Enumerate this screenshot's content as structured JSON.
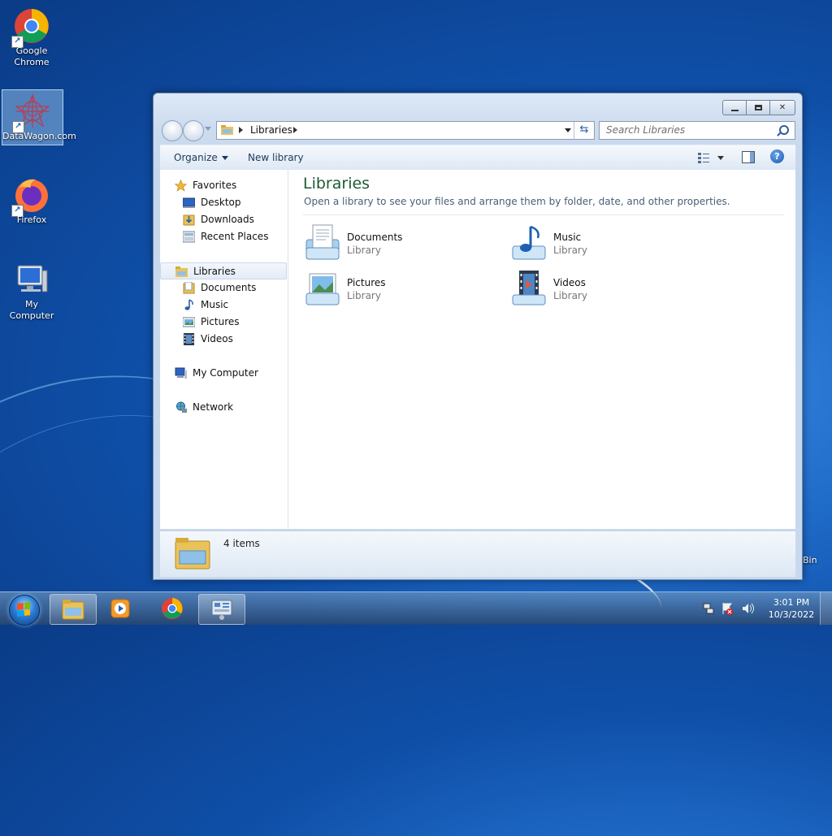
{
  "desktop": {
    "icons": [
      {
        "label": "Google Chrome",
        "icon": "chrome-icon"
      },
      {
        "label": "DataWagon.com",
        "icon": "datawagon-icon"
      },
      {
        "label": "Firefox",
        "icon": "firefox-icon"
      },
      {
        "label": "My Computer",
        "icon": "computer-icon"
      }
    ],
    "recycle_bin_label_fragment": "Bin"
  },
  "window": {
    "breadcrumb": "Libraries",
    "search_placeholder": "Search Libraries",
    "commands": {
      "organize": "Organize",
      "new_library": "New library"
    },
    "help_glyph": "?"
  },
  "nav_pane": {
    "favorites": {
      "label": "Favorites",
      "items": [
        "Desktop",
        "Downloads",
        "Recent Places"
      ]
    },
    "libraries": {
      "label": "Libraries",
      "items": [
        "Documents",
        "Music",
        "Pictures",
        "Videos"
      ]
    },
    "computer": "My Computer",
    "network": "Network"
  },
  "content": {
    "title": "Libraries",
    "subtitle": "Open a library to see your files and arrange them by folder, date, and other properties.",
    "libraries": [
      {
        "name": "Documents",
        "kind": "Library",
        "icon": "documents-library-icon"
      },
      {
        "name": "Music",
        "kind": "Library",
        "icon": "music-library-icon"
      },
      {
        "name": "Pictures",
        "kind": "Library",
        "icon": "pictures-library-icon"
      },
      {
        "name": "Videos",
        "kind": "Library",
        "icon": "videos-library-icon"
      }
    ]
  },
  "details_pane": {
    "count": "4 items"
  },
  "taskbar": {
    "clock": {
      "time": "3:01 PM",
      "date": "10/3/2022"
    },
    "pinned": [
      "explorer-icon",
      "media-player-icon",
      "chrome-icon",
      "control-panel-icon"
    ]
  },
  "colors": {
    "title_green": "#1e5a33",
    "wallpaper_blue": "#1f6cc9"
  }
}
